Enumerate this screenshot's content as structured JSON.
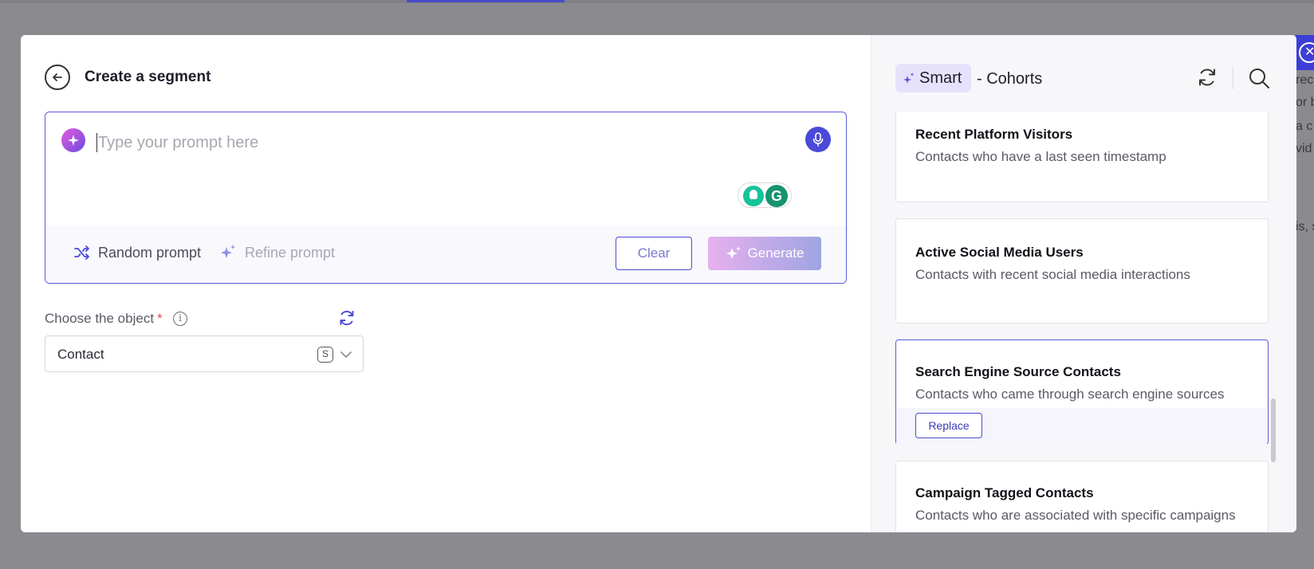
{
  "header": {
    "title": "Create a segment"
  },
  "prompt": {
    "placeholder": "Type your prompt here",
    "random_label": "Random prompt",
    "refine_label": "Refine prompt",
    "clear_label": "Clear",
    "generate_label": "Generate"
  },
  "object": {
    "label": "Choose the object",
    "required_mark": "*",
    "info": "i",
    "selected": "Contact",
    "badge": "S"
  },
  "right_panel": {
    "smart_label": "Smart",
    "cohorts_label": "- Cohorts",
    "cards": [
      {
        "title": "Recent Platform Visitors",
        "desc": "Contacts who have a last seen timestamp"
      },
      {
        "title": "Active Social Media Users",
        "desc": "Contacts with recent social media interactions"
      },
      {
        "title": "Search Engine Source Contacts",
        "desc": "Contacts who came through search engine sources",
        "action": "Replace"
      },
      {
        "title": "Campaign Tagged Contacts",
        "desc": "Contacts who are associated with specific campaigns"
      }
    ]
  },
  "colors": {
    "accent": "#4a4ad8",
    "selected_border": "#5b5bdb",
    "overlay": "#8a8a8f"
  },
  "background_fragments": [
    "reco",
    "or b",
    "a c",
    "vid",
    "is, s"
  ]
}
